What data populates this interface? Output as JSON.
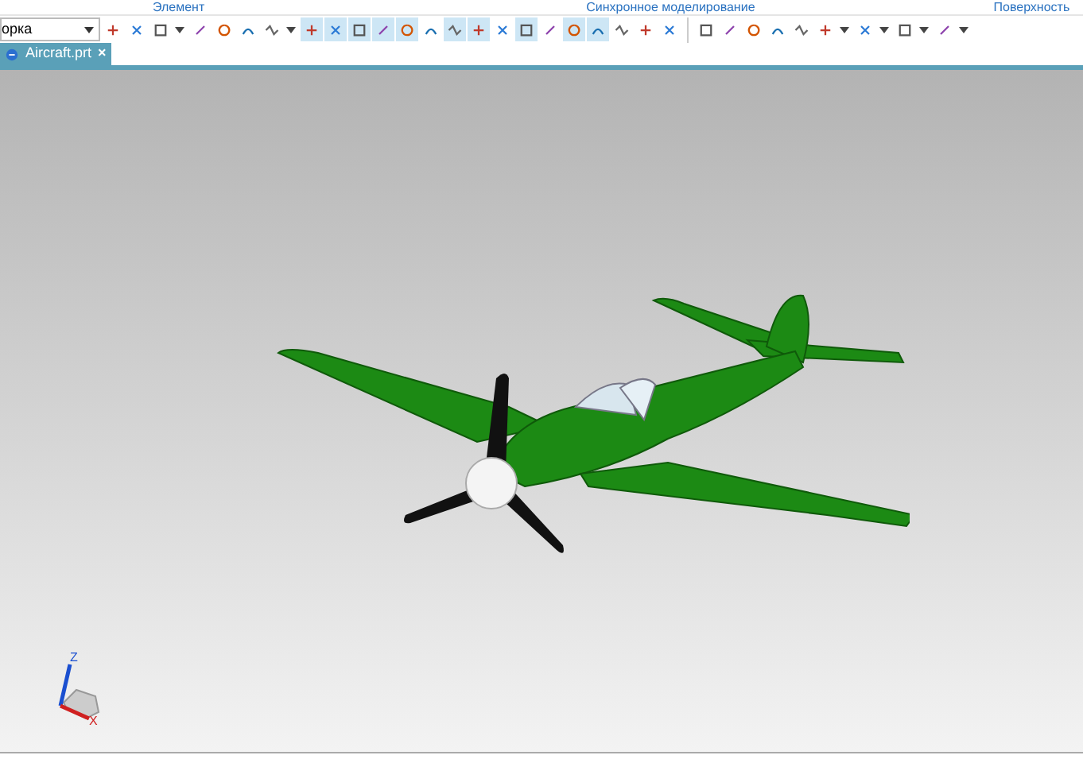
{
  "ribbon_groups": [
    "Элемент",
    "Синхронное моделирование",
    "Поверхность"
  ],
  "selection_filter": {
    "value": "орка"
  },
  "toolbar_buttons": [
    {
      "selected": false,
      "dropdown": false
    },
    {
      "selected": false,
      "dropdown": false
    },
    {
      "selected": false,
      "dropdown": true
    },
    {
      "selected": false,
      "dropdown": false
    },
    {
      "selected": false,
      "dropdown": false
    },
    {
      "selected": false,
      "dropdown": false
    },
    {
      "selected": false,
      "dropdown": true
    },
    {
      "selected": true,
      "dropdown": false
    },
    {
      "selected": true,
      "dropdown": false
    },
    {
      "selected": true,
      "dropdown": false
    },
    {
      "selected": true,
      "dropdown": false
    },
    {
      "selected": true,
      "dropdown": false
    },
    {
      "selected": false,
      "dropdown": false
    },
    {
      "selected": true,
      "dropdown": false
    },
    {
      "selected": true,
      "dropdown": false
    },
    {
      "selected": false,
      "dropdown": false
    },
    {
      "selected": true,
      "dropdown": false
    },
    {
      "selected": false,
      "dropdown": false
    },
    {
      "selected": true,
      "dropdown": false
    },
    {
      "selected": true,
      "dropdown": false
    },
    {
      "selected": false,
      "dropdown": false
    },
    {
      "selected": false,
      "dropdown": false
    },
    {
      "selected": false,
      "dropdown": false
    },
    {
      "selected": false,
      "dropdown": false
    },
    {
      "selected": false,
      "dropdown": false
    },
    {
      "selected": false,
      "dropdown": false
    },
    {
      "selected": false,
      "dropdown": false
    },
    {
      "selected": false,
      "dropdown": false
    },
    {
      "selected": false,
      "dropdown": true
    },
    {
      "selected": false,
      "dropdown": true
    },
    {
      "selected": false,
      "dropdown": true
    },
    {
      "selected": false,
      "dropdown": true
    }
  ],
  "tabs": [
    {
      "label": "Aircraft.prt",
      "close": "×",
      "selected": true
    }
  ],
  "triad": {
    "z_label": "Z",
    "x_label": "X"
  }
}
